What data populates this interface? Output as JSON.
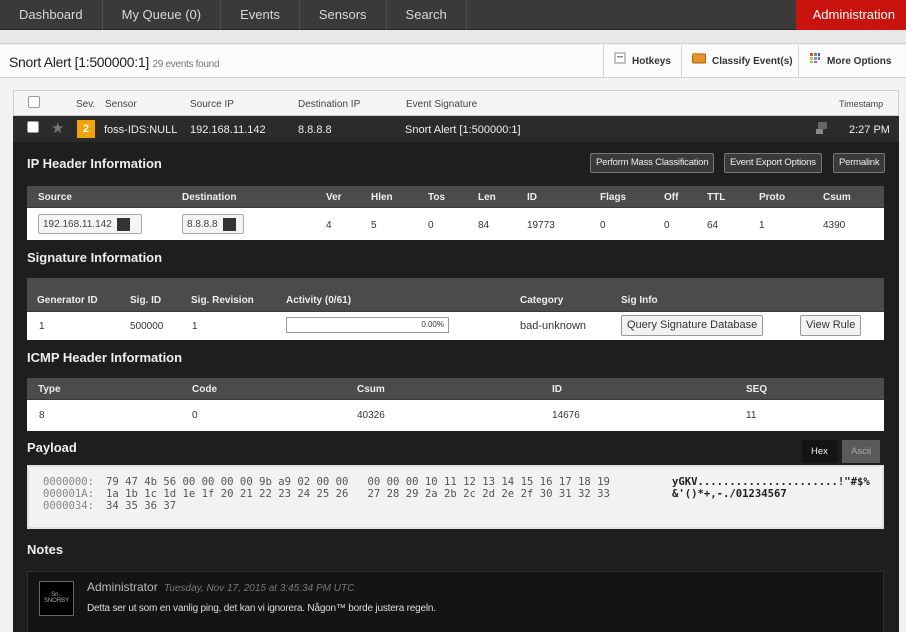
{
  "nav": {
    "tabs": [
      "Dashboard",
      "My Queue (0)",
      "Events",
      "Sensors",
      "Search"
    ],
    "admin": "Administration"
  },
  "titlebar": {
    "title": "Snort Alert [1:500000:1]",
    "count": "29 events found",
    "hotkeys": "Hotkeys",
    "classify": "Classify Event(s)",
    "more": "More Options"
  },
  "list_header": {
    "sev": "Sev.",
    "sensor": "Sensor",
    "source_ip": "Source IP",
    "destination_ip": "Destination IP",
    "signature": "Event Signature",
    "timestamp": "Timestamp"
  },
  "event": {
    "severity": "2",
    "sensor": "foss-IDS:NULL",
    "source_ip": "192.168.11.142",
    "destination_ip": "8.8.8.8",
    "signature": "Snort Alert [1:500000:1]",
    "time": "2:27 PM"
  },
  "ip_header": {
    "title": "IP Header Information",
    "buttons": {
      "mass": "Perform Mass Classification",
      "export": "Event Export Options",
      "permalink": "Permalink"
    },
    "cols": [
      "Source",
      "Destination",
      "Ver",
      "Hlen",
      "Tos",
      "Len",
      "ID",
      "Flags",
      "Off",
      "TTL",
      "Proto",
      "Csum"
    ],
    "row": {
      "source": "192.168.11.142",
      "destination": "8.8.8.8",
      "ver": "4",
      "hlen": "5",
      "tos": "0",
      "len": "84",
      "id": "19773",
      "flags": "0",
      "off": "0",
      "ttl": "64",
      "proto": "1",
      "csum": "4390"
    }
  },
  "signature": {
    "title": "Signature Information",
    "cols": [
      "Generator ID",
      "Sig. ID",
      "Sig. Revision",
      "Activity (0/61)",
      "Category",
      "Sig Info"
    ],
    "row": {
      "gen_id": "1",
      "sig_id": "500000",
      "revision": "1",
      "activity": "0.00%",
      "activity_fraction": 0.0,
      "category": "bad-unknown",
      "query_btn": "Query Signature Database",
      "view_rule_btn": "View Rule"
    }
  },
  "icmp": {
    "title": "ICMP Header Information",
    "cols": [
      "Type",
      "Code",
      "Csum",
      "ID",
      "SEQ"
    ],
    "row": {
      "type": "8",
      "code": "0",
      "csum": "40326",
      "id": "14676",
      "seq": "11"
    }
  },
  "payload": {
    "title": "Payload",
    "hex_tab": "Hex",
    "ascii_tab": "Ascii",
    "offsets": "0000000:\n000001A:\n0000034:",
    "hex": "79 47 4b 56 00 00 00 00 9b a9 02 00 00   00 00 00 10 11 12 13 14 15 16 17 18 19\n1a 1b 1c 1d 1e 1f 20 21 22 23 24 25 26   27 28 29 2a 2b 2c 2d 2e 2f 30 31 32 33\n34 35 36 37",
    "ascii": "yGKV......................!\"#$%&'()*+,-./01234567"
  },
  "notes": {
    "title": "Notes",
    "author": "Administrator",
    "date": "Tuesday, Nov 17, 2015 at 3:45:34 PM UTC",
    "text": "Detta ser ut som en vanlig ping, det kan vi ignorera. Någon™ borde justera regeln.",
    "avatar_text": "Sn.. SNORBY"
  },
  "colors": {
    "admin": "#c8130f",
    "severity": "#f0a30a",
    "panel": "#1e1e1e",
    "table_head": "#4b4b4b"
  }
}
